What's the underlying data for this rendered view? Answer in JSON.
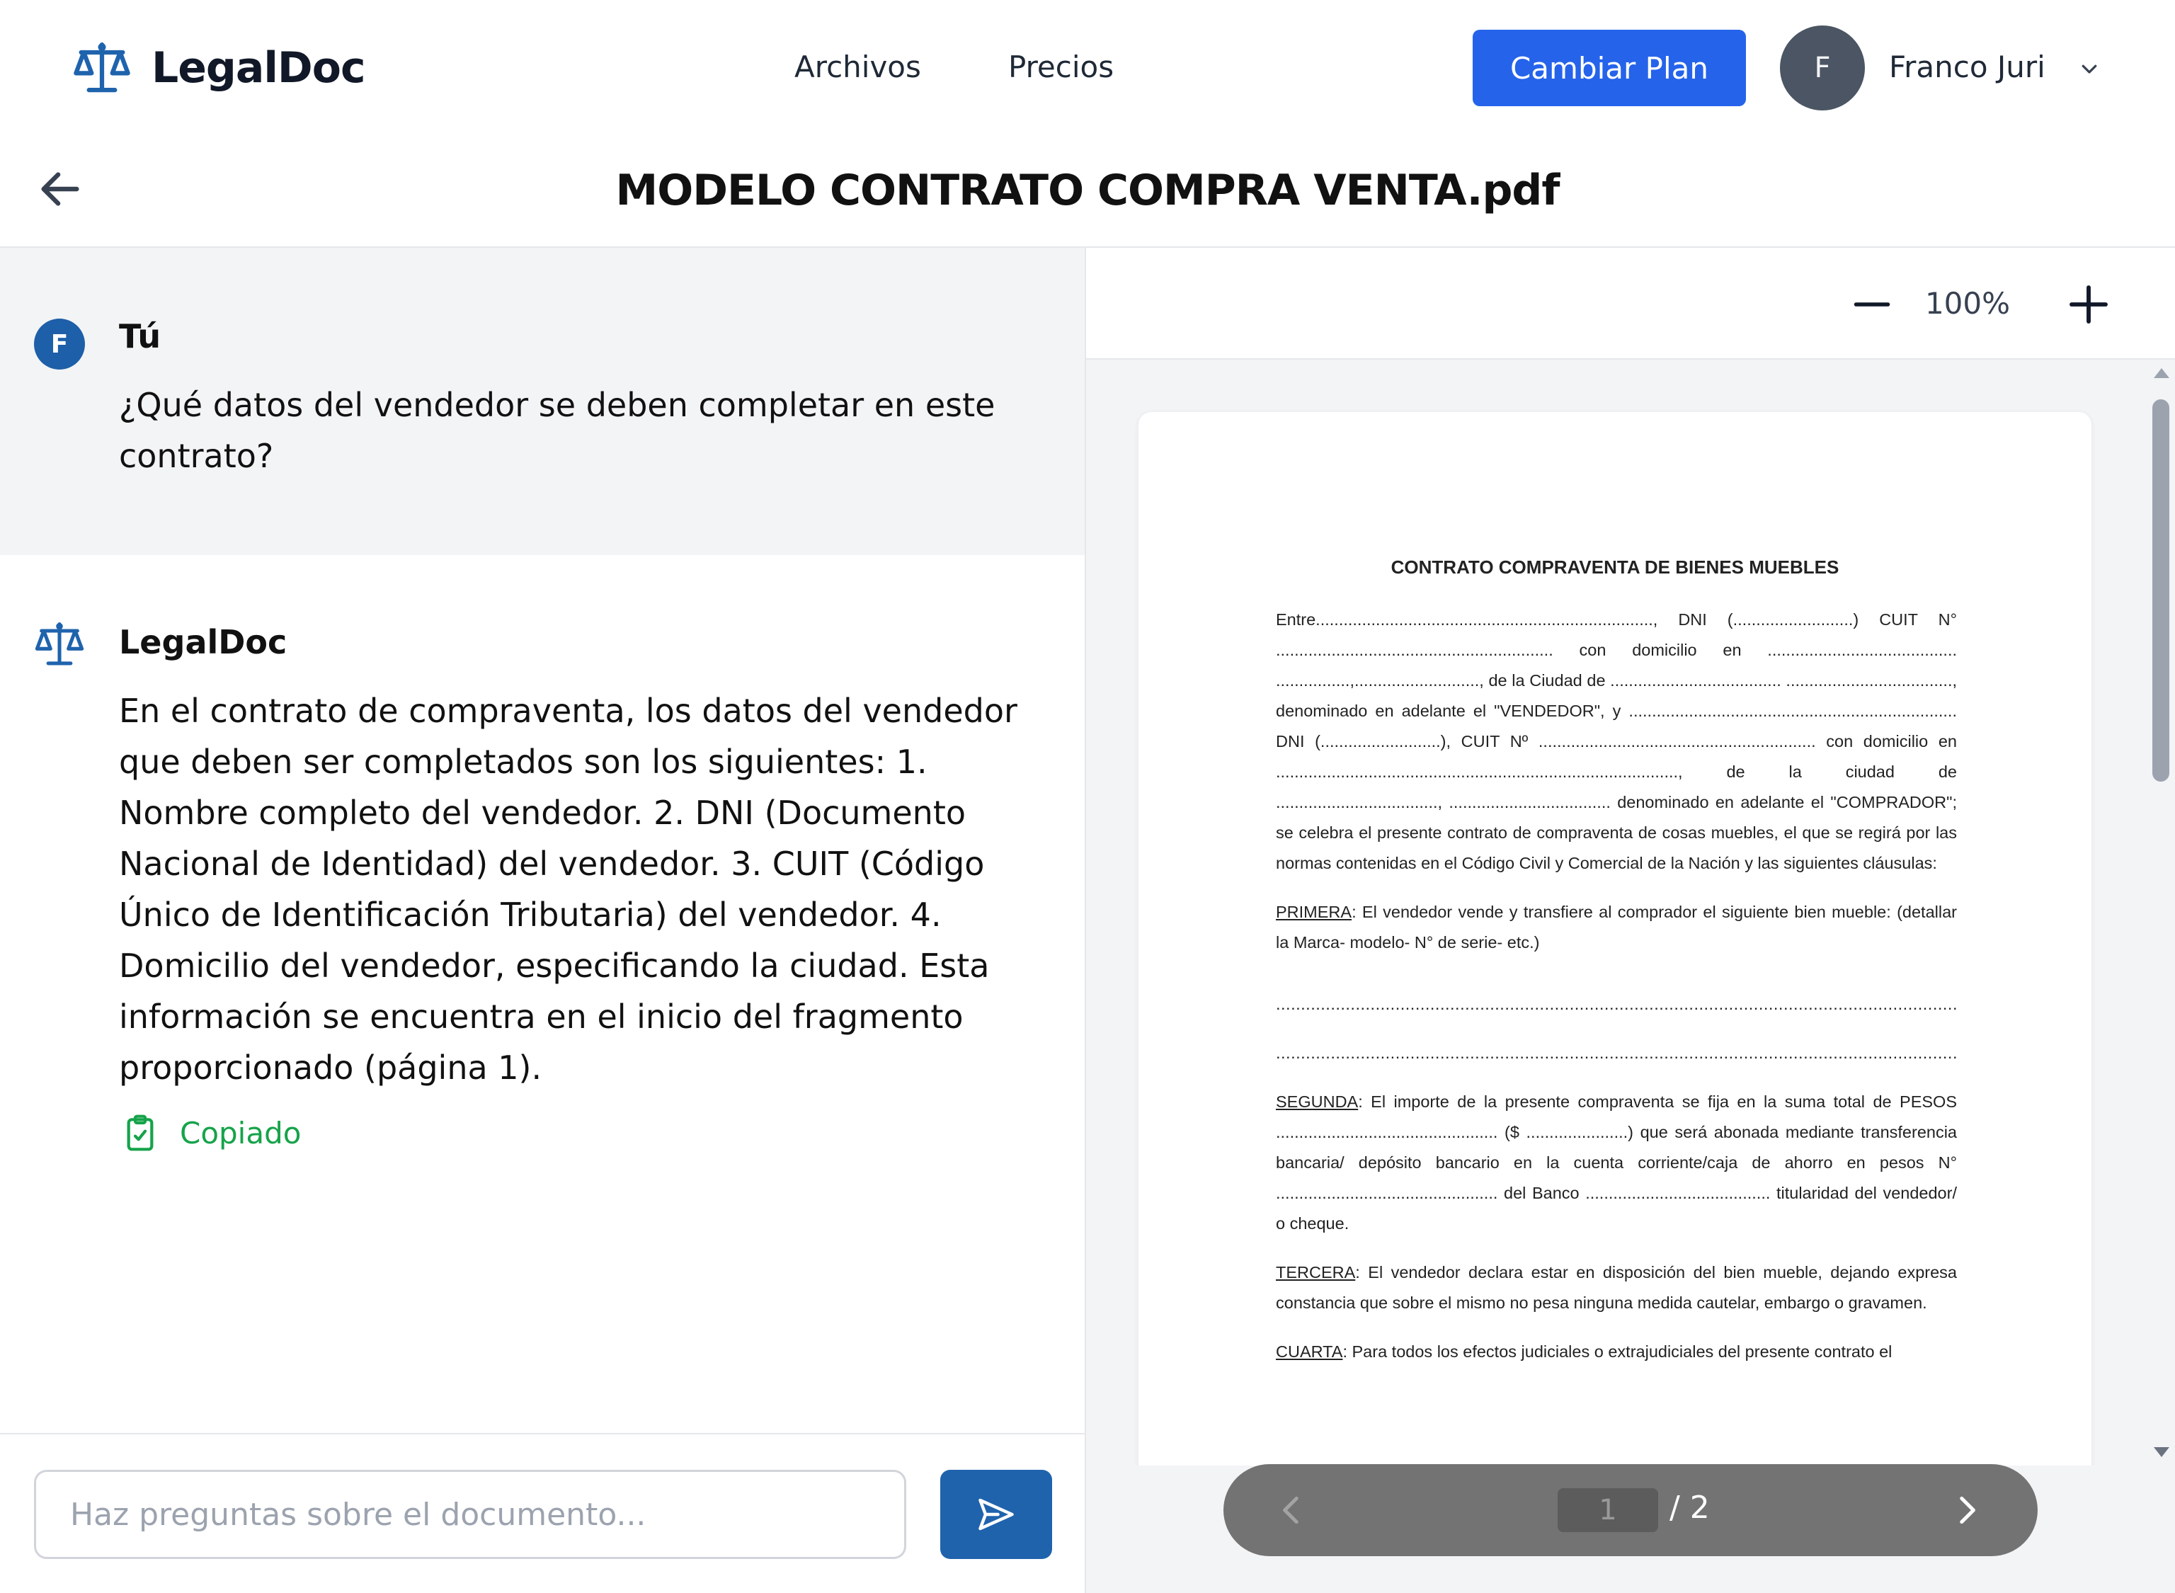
{
  "header": {
    "logo_text": "LegalDoc",
    "nav": {
      "archivos": "Archivos",
      "precios": "Precios"
    },
    "plan_button": "Cambiar Plan",
    "avatar_initial": "F",
    "user_name": "Franco Juri"
  },
  "document": {
    "title": "MODELO CONTRATO COMPRA VENTA.pdf"
  },
  "chat": {
    "user": {
      "initial": "F",
      "label": "Tú",
      "text": "¿Qué datos del vendedor se deben completar en este contrato?"
    },
    "bot": {
      "label": "LegalDoc",
      "text": "En el contrato de compraventa, los datos del vendedor que deben ser completados son los siguientes: 1. Nombre completo del vendedor. 2. DNI (Documento Nacional de Identidad) del vendedor. 3. CUIT (Código Único de Identificación Tributaria) del vendedor. 4. Domicilio del vendedor, especificando la ciudad. Esta información se encuentra en el inicio del fragmento proporcionado (página 1).",
      "copy_status": "Copiado"
    },
    "input_placeholder": "Haz preguntas sobre el documento..."
  },
  "viewer": {
    "zoom": "100%",
    "page_input": "1",
    "page_total": "/ 2",
    "pdf": {
      "title": "CONTRATO COMPRAVENTA DE BIENES MUEBLES",
      "intro": "Entre........................................................................., DNI (..........................) CUIT N° ............................................................ con domicilio en ......................................... ................,..........................., de la Ciudad de ..................................... ...................................., denominado en adelante el \"VENDEDOR\", y ....................................................................... DNI (..........................), CUIT Nº ............................................................ con domicilio en ......................................................................................., de la ciudad de ..................................., ................................... denominado en adelante el \"COMPRADOR\"; se celebra el presente contrato de compraventa de cosas muebles, el que se regirá por las normas contenidas en el Código Civil y Comercial de la Nación y las siguientes cláusulas:",
      "primera_label": "PRIMERA",
      "primera_text": ": El vendedor vende y transfiere al comprador el siguiente bien mueble: (detallar la Marca- modelo- N° de serie- etc.)",
      "dotted_line_1": "..........................................................................................................................................................",
      "dotted_line_2": "..........................................................................................................................................................",
      "segunda_label": "SEGUNDA",
      "segunda_text": ": El importe de la presente compraventa se fija en la suma total de PESOS ................................................ ($ ......................) que será abonada mediante transferencia bancaria/ depósito bancario en la cuenta corriente/caja de ahorro en pesos N° ................................................ del Banco ........................................ titularidad del vendedor/ o cheque.",
      "tercera_label": "TERCERA",
      "tercera_text": ": El vendedor declara estar en disposición del bien mueble, dejando expresa constancia que sobre el mismo no pesa ninguna medida cautelar, embargo o gravamen.",
      "cuarta_label": "CUARTA",
      "cuarta_text": ": Para todos los efectos judiciales o extrajudiciales del presente contrato el"
    }
  },
  "colors": {
    "primary": "#2563eb",
    "brand_blue": "#1f63ad",
    "success": "#16a34a",
    "pager_bg": "#737373"
  }
}
